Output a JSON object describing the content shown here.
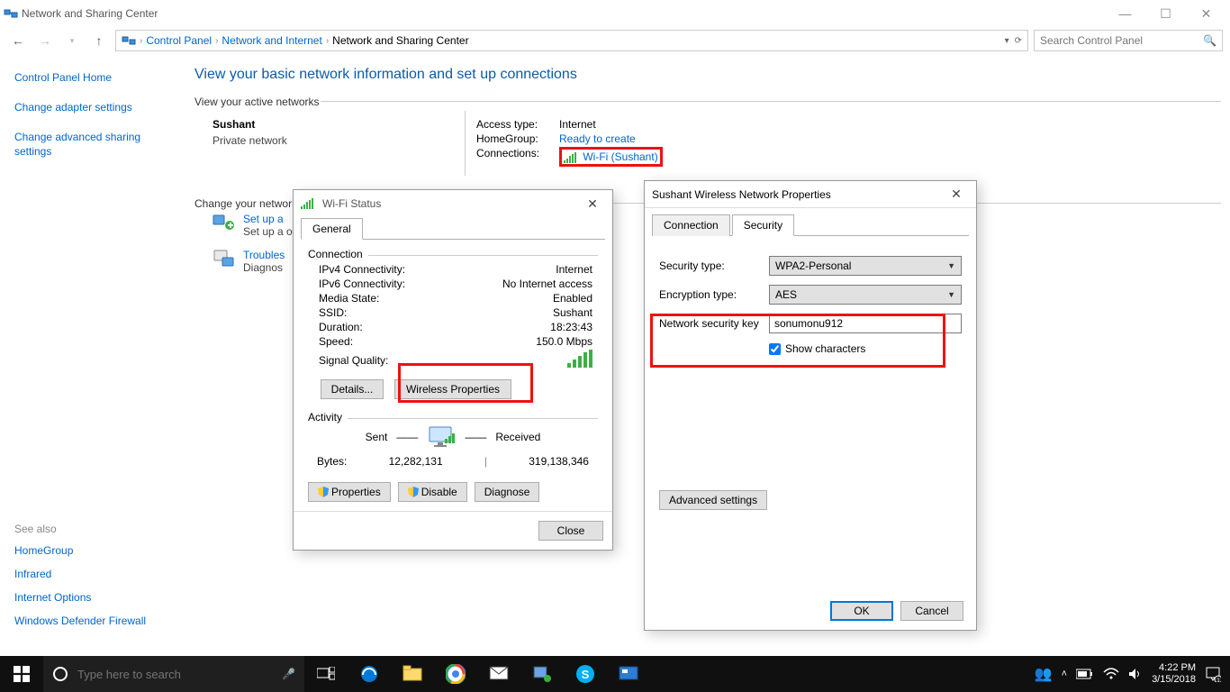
{
  "window": {
    "title": "Network and Sharing Center"
  },
  "breadcrumb": {
    "items": [
      "Control Panel",
      "Network and Internet",
      "Network and Sharing Center"
    ]
  },
  "searchPlaceholder": "Search Control Panel",
  "leftPane": {
    "home": "Control Panel Home",
    "links": [
      "Change adapter settings",
      "Change advanced sharing settings"
    ]
  },
  "heading": "View your basic network information and set up connections",
  "sectionActive": "View your active networks",
  "network": {
    "name": "Sushant",
    "subtype": "Private network",
    "accessTypeK": "Access type:",
    "accessTypeV": "Internet",
    "homeGroupK": "HomeGroup:",
    "homeGroupV": "Ready to create",
    "connectionsK": "Connections:",
    "connectionsV": "Wi-Fi (Sushant)"
  },
  "sectionChange": "Change your networking settings",
  "setUp": {
    "title": "Set up a",
    "desc": "Set up a                                                                                                                            oint."
  },
  "trouble": {
    "title": "Troubles",
    "desc": "Diagnos"
  },
  "seeAlso": {
    "label": "See also",
    "links": [
      "HomeGroup",
      "Infrared",
      "Internet Options",
      "Windows Defender Firewall"
    ]
  },
  "wifiStatus": {
    "title": "Wi-Fi Status",
    "tabGeneral": "General",
    "groupConnection": "Connection",
    "ipv4K": "IPv4 Connectivity:",
    "ipv4V": "Internet",
    "ipv6K": "IPv6 Connectivity:",
    "ipv6V": "No Internet access",
    "mediaK": "Media State:",
    "mediaV": "Enabled",
    "ssidK": "SSID:",
    "ssidV": "Sushant",
    "durK": "Duration:",
    "durV": "18:23:43",
    "speedK": "Speed:",
    "speedV": "150.0 Mbps",
    "sigK": "Signal Quality:",
    "btnDetails": "Details...",
    "btnWirelessProps": "Wireless Properties",
    "groupActivity": "Activity",
    "sent": "Sent",
    "received": "Received",
    "bytesK": "Bytes:",
    "bytesSent": "12,282,131",
    "bytesRecv": "319,138,346",
    "btnProperties": "Properties",
    "btnDisable": "Disable",
    "btnDiagnose": "Diagnose",
    "btnClose": "Close"
  },
  "wirelessProps": {
    "title": "Sushant Wireless Network Properties",
    "tabConnection": "Connection",
    "tabSecurity": "Security",
    "secTypeK": "Security type:",
    "secTypeV": "WPA2-Personal",
    "encK": "Encryption type:",
    "encV": "AES",
    "keyK": "Network security key",
    "keyV": "sonumonu912",
    "showChars": "Show characters",
    "btnAdvanced": "Advanced settings",
    "btnOK": "OK",
    "btnCancel": "Cancel"
  },
  "taskbar": {
    "searchPlaceholder": "Type here to search",
    "time": "4:22 PM",
    "date": "3/15/2018"
  }
}
